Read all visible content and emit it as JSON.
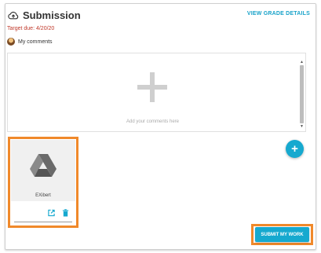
{
  "header": {
    "title": "Submission",
    "title_icon": "cloud-upload-icon",
    "view_grade_label": "VIEW GRADE DETAILS"
  },
  "due": {
    "text": "Target due: 4/20/20"
  },
  "comments": {
    "label": "My comments",
    "placeholder": "Add your comments here",
    "avatar_icon": "user-avatar"
  },
  "fab": {
    "label": "+",
    "icon": "add-icon"
  },
  "attachment": {
    "name": "EXibert",
    "thumbnail_icon": "google-drive-icon",
    "open_icon": "open-external-icon",
    "delete_icon": "trash-icon"
  },
  "submit": {
    "label": "SUBMIT MY WORK"
  },
  "colors": {
    "accent": "#16a9cf",
    "due_text": "#c0392b",
    "highlight": "#f0892a"
  }
}
